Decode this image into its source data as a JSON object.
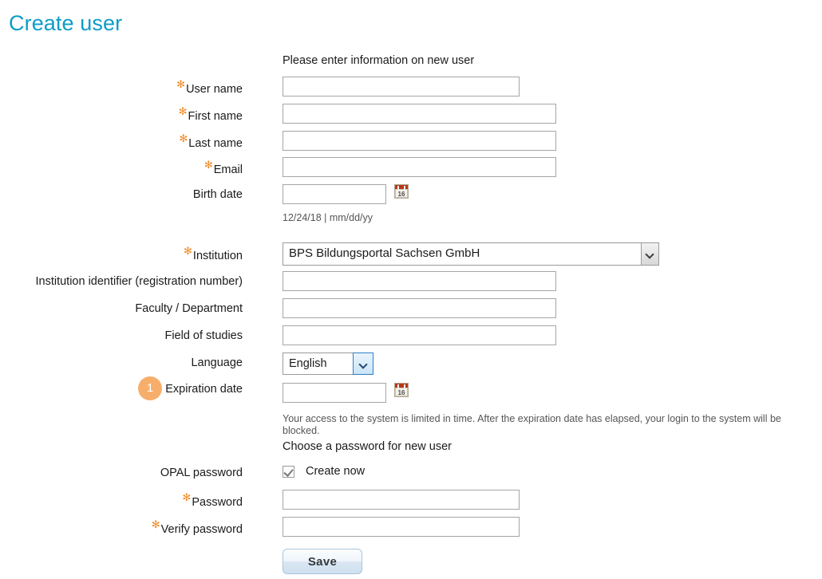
{
  "page": {
    "title": "Create user",
    "title_color": "#0e9cc8"
  },
  "sections": {
    "user_info_heading": "Please enter information on new user",
    "password_heading": "Choose a password for new user"
  },
  "fields": {
    "user_name": {
      "label": "User name",
      "required": true,
      "value": "",
      "placeholder": ""
    },
    "first_name": {
      "label": "First name",
      "required": true,
      "value": "",
      "placeholder": ""
    },
    "last_name": {
      "label": "Last name",
      "required": true,
      "value": "",
      "placeholder": ""
    },
    "email": {
      "label": "Email",
      "required": true,
      "value": "",
      "placeholder": ""
    },
    "birth_date": {
      "label": "Birth date",
      "required": false,
      "value": "",
      "placeholder": "",
      "hint": "12/24/18 | mm/dd/yy",
      "calendar_icon": "calendar-icon",
      "calendar_day": "16"
    },
    "institution": {
      "label": "Institution",
      "required": true,
      "selected": "BPS Bildungsportal Sachsen GmbH",
      "dropdown_icon": "chevron-down-icon"
    },
    "institution_identifier": {
      "label": "Institution identifier (registration number)",
      "required": false,
      "value": "",
      "placeholder": ""
    },
    "faculty": {
      "label": "Faculty / Department",
      "required": false,
      "value": "",
      "placeholder": ""
    },
    "field_of_studies": {
      "label": "Field of studies",
      "required": false,
      "value": "",
      "placeholder": ""
    },
    "language": {
      "label": "Language",
      "required": false,
      "selected": "English",
      "dropdown_icon": "chevron-down-icon"
    },
    "expiration_date": {
      "label": "Expiration date",
      "required": false,
      "badge": "1",
      "badge_color": "#f7ae6a",
      "value": "",
      "placeholder": "",
      "calendar_icon": "calendar-icon",
      "calendar_day": "16",
      "hint": "Your access to the system is limited in time. After the expiration date has elapsed, your login to the system will be blocked."
    },
    "opal_password": {
      "label": "OPAL password",
      "required": false,
      "checkbox_label": "Create now",
      "checked": true
    },
    "password": {
      "label": "Password",
      "required": true,
      "value": "",
      "placeholder": ""
    },
    "verify_password": {
      "label": "Verify password",
      "required": true,
      "value": "",
      "placeholder": ""
    }
  },
  "actions": {
    "save_label": "Save"
  },
  "markers": {
    "required_asterisk": "✻"
  }
}
